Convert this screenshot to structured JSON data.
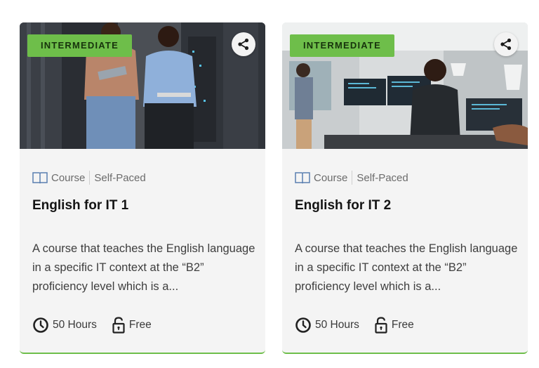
{
  "cards": [
    {
      "level_badge": "INTERMEDIATE",
      "type": "Course",
      "pace": "Self-Paced",
      "title": "English for IT 1",
      "description": "A course that teaches the English language in a specific IT context at the “B2” proficiency level which is a...",
      "duration": "50 Hours",
      "price": "Free",
      "icons": {
        "share": "share-icon",
        "type": "book-icon",
        "duration": "clock-icon",
        "price": "unlock-icon"
      }
    },
    {
      "level_badge": "INTERMEDIATE",
      "type": "Course",
      "pace": "Self-Paced",
      "title": "English for IT 2",
      "description": "A course that teaches the English language in a specific IT context at the “B2” proficiency level which is a...",
      "duration": "50 Hours",
      "price": "Free",
      "icons": {
        "share": "share-icon",
        "type": "book-icon",
        "duration": "clock-icon",
        "price": "unlock-icon"
      }
    }
  ],
  "colors": {
    "badge": "#6ebe4a",
    "card_bg": "#f4f4f4",
    "accent_border": "#6ebe4a"
  }
}
